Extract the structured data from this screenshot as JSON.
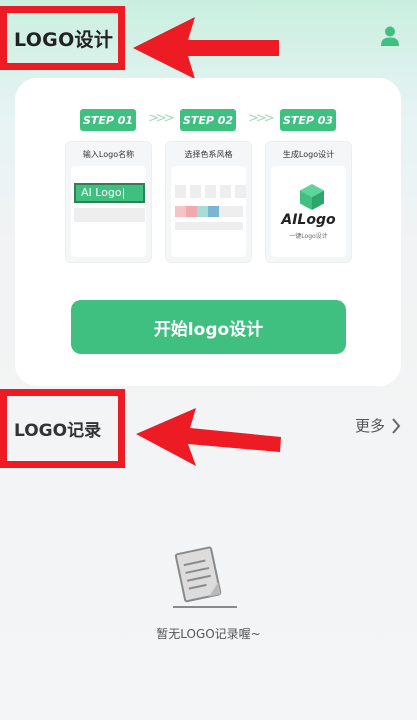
{
  "header": {
    "title": "LOGO设计",
    "user_icon": "user-icon"
  },
  "steps": [
    {
      "label": "STEP 01",
      "title": "输入Logo名称",
      "input_value": "AI Logo|"
    },
    {
      "label": "STEP 02",
      "title": "选择色系风格"
    },
    {
      "label": "STEP 03",
      "title": "生成Logo设计",
      "logo_text": "AILogo",
      "logo_subtext": "一键Logo设计"
    }
  ],
  "step_chevrons": ">>>",
  "start_button": {
    "label": "开始logo设计"
  },
  "records": {
    "title": "LOGO记录",
    "more_label": "更多",
    "empty_text": "暂无LOGO记录喔~"
  },
  "colors": {
    "accent": "#3fbf80",
    "annotation_red": "#ec1b24",
    "swatches": [
      "#f6c3c6",
      "#f3a8ad",
      "#a6ddd8",
      "#7ab6d3"
    ]
  }
}
